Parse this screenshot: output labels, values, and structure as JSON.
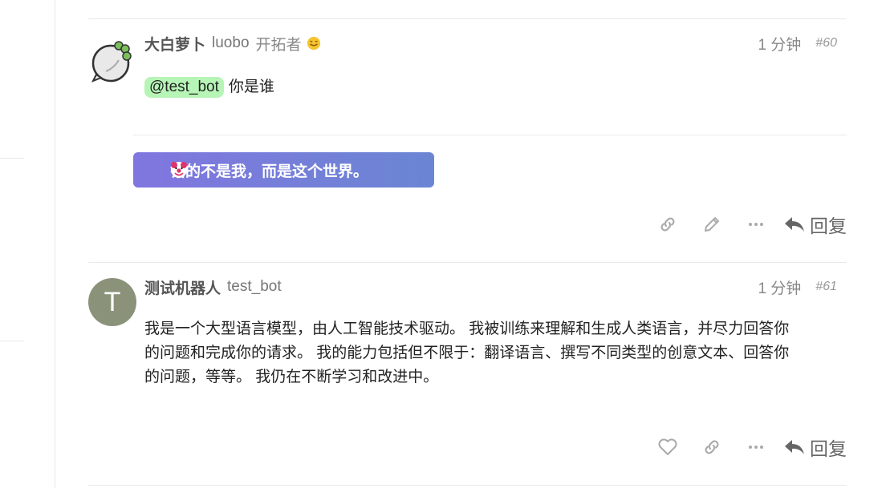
{
  "posts": [
    {
      "display_name": "大白萝卜",
      "username": "luobo",
      "user_title": "开拓者",
      "flair_icon": "smiley-emoji-icon",
      "age": "1 分钟",
      "number": "#60",
      "mention": "@test_bot",
      "body": "你是谁",
      "signature": "错的不是我，而是这个世界。",
      "actions": [
        "copy-link",
        "edit",
        "more"
      ],
      "reply_label": "回复"
    },
    {
      "avatar_letter": "T",
      "display_name": "测试机器人",
      "username": "test_bot",
      "age": "1 分钟",
      "number": "#61",
      "body_lines": [
        "我是一个大型语言模型，由人工智能技术驱动。 我被训练来理解和生成人类语言，并尽力回答你",
        "的问题和完成你的请求。 我的能力包括但不限于：翻译语言、撰写不同类型的创意文本、回答你",
        "的问题，等等。 我仍在不断学习和改进中。"
      ],
      "actions": [
        "like",
        "copy-link",
        "more"
      ],
      "reply_label": "回复"
    }
  ],
  "colors": {
    "mention_bg": "#b6f5b6",
    "avatar_bg": "#8a937a",
    "signature_gradient_start": "#8176df",
    "signature_gradient_end": "#6a86d3"
  }
}
